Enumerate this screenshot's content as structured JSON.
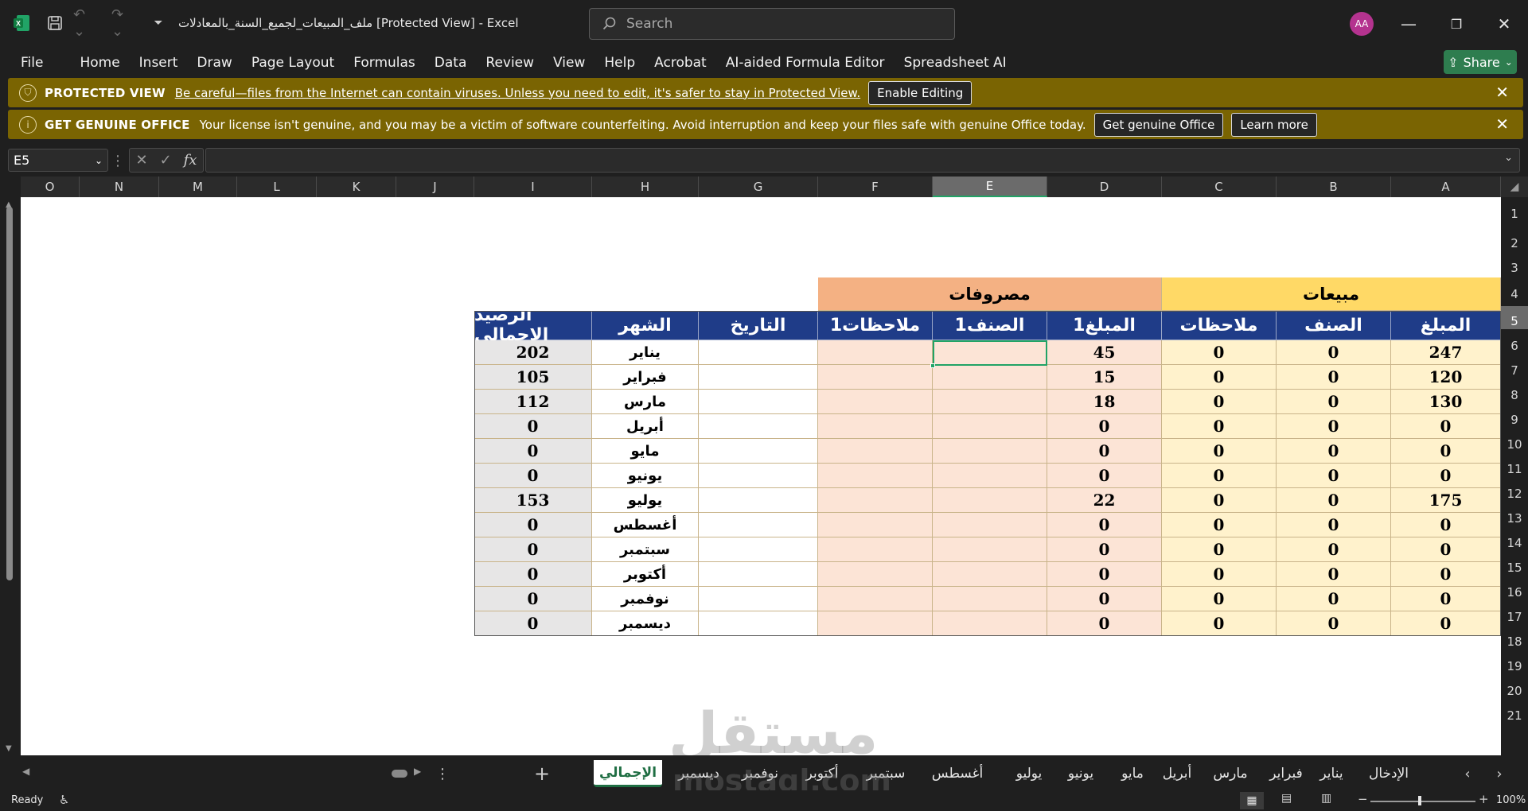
{
  "app": {
    "title": "ملف_المبيعات_لجميع_السنة_بالمعادلات  [Protected View]  -  Excel",
    "search_placeholder": "Search",
    "avatar_initials": "AA",
    "share_label": "Share"
  },
  "ribbon_tabs": [
    "File",
    "Home",
    "Insert",
    "Draw",
    "Page Layout",
    "Formulas",
    "Data",
    "Review",
    "View",
    "Help",
    "Acrobat",
    "AI-aided Formula Editor",
    "Spreadsheet AI"
  ],
  "protected_view": {
    "heading": "PROTECTED VIEW",
    "message": "Be careful—files from the Internet can contain viruses. Unless you need to edit, it's safer to stay in Protected View.",
    "button": "Enable Editing"
  },
  "genuine_office": {
    "heading": "GET GENUINE OFFICE",
    "message": "Your license isn't genuine, and you may be a victim of software counterfeiting. Avoid interruption and keep your files safe with genuine Office today.",
    "button1": "Get genuine Office",
    "button2": "Learn more"
  },
  "formula_bar": {
    "name_box": "E5",
    "formula": "",
    "fx": "fx"
  },
  "columns": [
    "O",
    "N",
    "M",
    "L",
    "K",
    "J",
    "I",
    "H",
    "G",
    "F",
    "E",
    "D",
    "C",
    "B",
    "A"
  ],
  "rows": [
    "1",
    "2",
    "3",
    "4",
    "5",
    "6",
    "7",
    "8",
    "9",
    "10",
    "11",
    "12",
    "13",
    "14",
    "15",
    "16",
    "17",
    "18",
    "19",
    "20",
    "21"
  ],
  "table": {
    "group_sales": "مبيعات",
    "group_expenses": "مصروفات",
    "headers": {
      "A": "المبلغ",
      "B": "الصنف",
      "C": "ملاحظات",
      "D": "المبلغ1",
      "E": "الصنف1",
      "F": "ملاحظات1",
      "G": "التاريخ",
      "H": "الشهر",
      "I": "الرصيد الإجمالي"
    },
    "data_rows": [
      {
        "A": "247",
        "B": "0",
        "C": "0",
        "D": "45",
        "H": "يناير",
        "I": "202"
      },
      {
        "A": "120",
        "B": "0",
        "C": "0",
        "D": "15",
        "H": "فبراير",
        "I": "105"
      },
      {
        "A": "130",
        "B": "0",
        "C": "0",
        "D": "18",
        "H": "مارس",
        "I": "112"
      },
      {
        "A": "0",
        "B": "0",
        "C": "0",
        "D": "0",
        "H": "أبريل",
        "I": "0"
      },
      {
        "A": "0",
        "B": "0",
        "C": "0",
        "D": "0",
        "H": "مايو",
        "I": "0"
      },
      {
        "A": "0",
        "B": "0",
        "C": "0",
        "D": "0",
        "H": "يونيو",
        "I": "0"
      },
      {
        "A": "175",
        "B": "0",
        "C": "0",
        "D": "22",
        "H": "يوليو",
        "I": "153"
      },
      {
        "A": "0",
        "B": "0",
        "C": "0",
        "D": "0",
        "H": "أغسطس",
        "I": "0"
      },
      {
        "A": "0",
        "B": "0",
        "C": "0",
        "D": "0",
        "H": "سبتمبر",
        "I": "0"
      },
      {
        "A": "0",
        "B": "0",
        "C": "0",
        "D": "0",
        "H": "أكتوبر",
        "I": "0"
      },
      {
        "A": "0",
        "B": "0",
        "C": "0",
        "D": "0",
        "H": "نوفمبر",
        "I": "0"
      },
      {
        "A": "0",
        "B": "0",
        "C": "0",
        "D": "0",
        "H": "ديسمبر",
        "I": "0"
      }
    ]
  },
  "sheet_tabs": [
    "الإدخال",
    "يناير",
    "فبراير",
    "مارس",
    "أبريل",
    "مايو",
    "يونيو",
    "يوليو",
    "أغسطس",
    "سبتمبر",
    "أكتوبر",
    "نوفمبر",
    "ديسمبر",
    "الإجمالي"
  ],
  "active_sheet": "الإجمالي",
  "watermark": {
    "arabic": "مستقل",
    "latin": "mostaql.com"
  },
  "status": {
    "ready": "Ready",
    "zoom": "100%"
  },
  "colors": {
    "header_blue": "#1f3c88",
    "sales_yellow": "#ffd966",
    "sales_fill": "#fff2cc",
    "expense_orange": "#f4b183",
    "expense_fill": "#fce4d6",
    "active_green": "#21a366"
  }
}
